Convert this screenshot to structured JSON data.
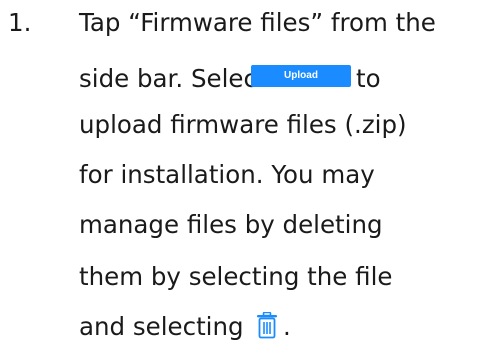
{
  "step": {
    "number": "1.",
    "lines": [
      "Tap “Firmware files” from the",
      "side bar. Select",
      "upload firmware files (.zip)",
      "for installation. You may",
      "manage files by deleting",
      "them by selecting the file",
      "and selecting"
    ],
    "after_button": "to",
    "end_punct": ".",
    "upload_button_label": "Upload",
    "trash_icon": "trash-icon",
    "accent": "#1a8cff"
  }
}
